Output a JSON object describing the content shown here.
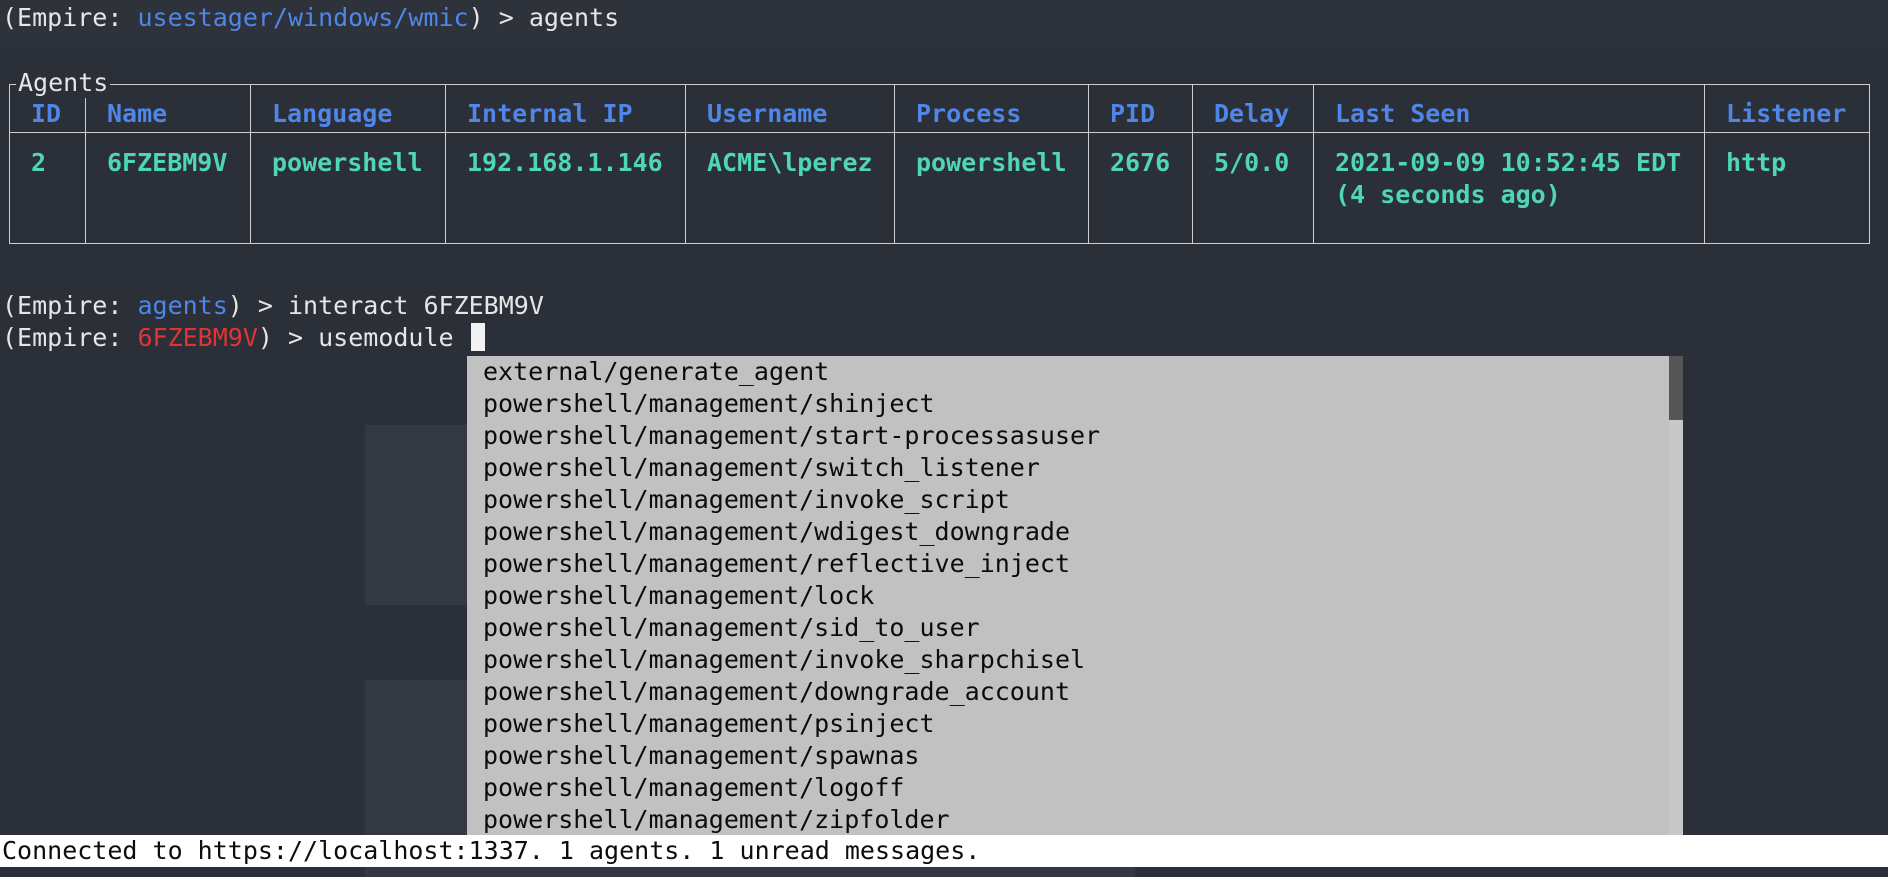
{
  "prompt_top": {
    "prefix": "(Empire: ",
    "context": "usestager/windows/wmic",
    "suffix": ") > ",
    "command": "agents"
  },
  "agents_table": {
    "legend": "Agents",
    "headers": [
      "ID",
      "Name",
      "Language",
      "Internal IP",
      "Username",
      "Process",
      "PID",
      "Delay",
      "Last Seen",
      "Listener"
    ],
    "rows": [
      {
        "id": "2",
        "name": "6FZEBM9V",
        "language": "powershell",
        "internal_ip": "192.168.1.146",
        "username": "ACME\\lperez",
        "process": "powershell",
        "pid": "2676",
        "delay": "5/0.0",
        "last_seen": "2021-09-09 10:52:45 EDT\n(4 seconds ago)",
        "listener": "http"
      }
    ]
  },
  "prompt_interact": {
    "prefix": "(Empire: ",
    "context": "agents",
    "suffix": ") > ",
    "command": "interact 6FZEBM9V"
  },
  "prompt_usemodule": {
    "prefix": "(Empire: ",
    "context": "6FZEBM9V",
    "suffix": ") > ",
    "command": "usemodule "
  },
  "completion_items": [
    "external/generate_agent",
    "powershell/management/shinject",
    "powershell/management/start-processasuser",
    "powershell/management/switch_listener",
    "powershell/management/invoke_script",
    "powershell/management/wdigest_downgrade",
    "powershell/management/reflective_inject",
    "powershell/management/lock",
    "powershell/management/sid_to_user",
    "powershell/management/invoke_sharpchisel",
    "powershell/management/downgrade_account",
    "powershell/management/psinject",
    "powershell/management/spawnas",
    "powershell/management/logoff",
    "powershell/management/zipfolder"
  ],
  "status_bar": {
    "text": "Connected to https://localhost:1337. 1 agents. 1 unread messages."
  },
  "colors": {
    "background": "#2b2f38",
    "prompt_context": "#4f86e8",
    "agent_context": "#e03434",
    "table_header": "#4f86e8",
    "table_cell": "#4fd6b8",
    "completion_bg": "#c1c1c1",
    "status_bg": "#ffffff"
  }
}
